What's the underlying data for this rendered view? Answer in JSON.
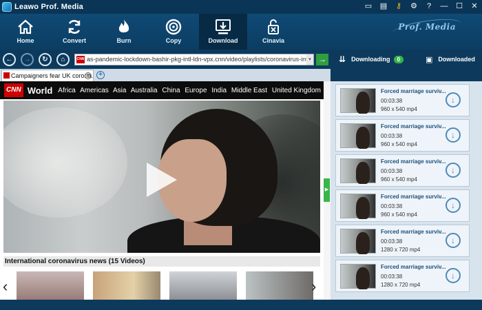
{
  "window": {
    "title": "Leawo Prof. Media"
  },
  "toolbar": {
    "tools": [
      {
        "label": "Home",
        "icon": "home-icon"
      },
      {
        "label": "Convert",
        "icon": "convert-icon"
      },
      {
        "label": "Burn",
        "icon": "burn-icon"
      },
      {
        "label": "Copy",
        "icon": "copy-icon"
      },
      {
        "label": "Download",
        "icon": "download-icon",
        "active": true
      },
      {
        "label": "Cinavia",
        "icon": "cinavia-icon"
      }
    ],
    "brand": "Prof. Media"
  },
  "navbar": {
    "url": "as-pandemic-lockdown-bashir-pkg-intl-ldn-vpx.cnn/video/playlists/coronavirus-intl/",
    "favicon_text": "CNN",
    "downloading_label": "Downloading",
    "downloading_count": "0",
    "downloaded_label": "Downloaded"
  },
  "tabs": [
    {
      "title": "Campaigners fear UK corona..."
    }
  ],
  "page": {
    "logo": "CNN",
    "section": "World",
    "nav": [
      "Africa",
      "Americas",
      "Asia",
      "Australia",
      "China",
      "Europe",
      "India",
      "Middle East",
      "United Kingdom"
    ],
    "playlist_title": "International coronavirus news (15 Videos)"
  },
  "downloads": [
    {
      "name": "Forced marriage surviv...",
      "duration": "00:03:38",
      "resolution": "960 x 540 mp4"
    },
    {
      "name": "Forced marriage surviv...",
      "duration": "00:03:38",
      "resolution": "960 x 540 mp4"
    },
    {
      "name": "Forced marriage surviv...",
      "duration": "00:03:38",
      "resolution": "960 x 540 mp4"
    },
    {
      "name": "Forced marriage surviv...",
      "duration": "00:03:38",
      "resolution": "960 x 540 mp4"
    },
    {
      "name": "Forced marriage surviv...",
      "duration": "00:03:38",
      "resolution": "1280 x 720 mp4"
    },
    {
      "name": "Forced marriage surviv...",
      "duration": "00:03:38",
      "resolution": "1280 x 720 mp4"
    }
  ],
  "colors": {
    "accent": "#39b54a",
    "chrome": "#0d3a5c",
    "link": "#1c4f7c"
  }
}
